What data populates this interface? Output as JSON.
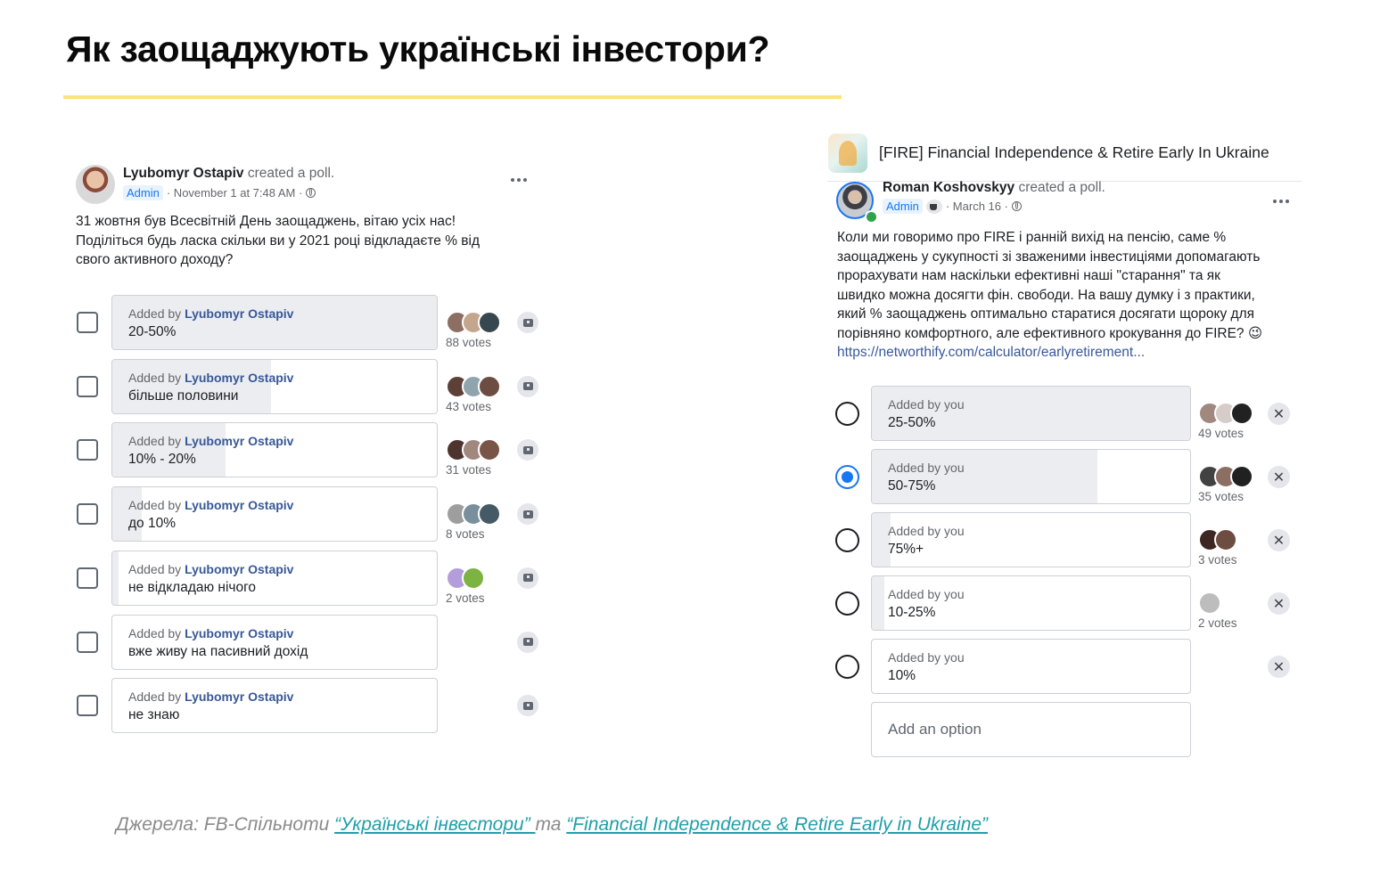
{
  "slide": {
    "title": "Як заощаджують українські інвестори?",
    "sources": {
      "prefix": "Джерела: FB-Спільноти ",
      "link1": "“Українські інвестори” ",
      "middle": "та ",
      "link2": "“Financial Independence & Retire Early in Ukraine”"
    }
  },
  "colors": {
    "accent_underline": "#fde27a",
    "facebook_blue": "#1877f2",
    "link_teal": "#1f9fa8"
  },
  "left_post": {
    "author": "Lyubomyr Ostapiv",
    "action": " created a poll.",
    "badge": "Admin",
    "meta": "· November 1 at 7:48 AM ·",
    "text": "31 жовтня був Всесвітній День заощаджень, вітаю усіх нас!\nПоділіться будь ласка скільки ви у 2021 році відкладаєте % від\nсвого активного доходу?",
    "added_by_prefix": "Added by ",
    "options": [
      {
        "added_by": "Lyubomyr Ostapiv",
        "label": "20-50%",
        "votes": "88 votes",
        "share": 1.0,
        "voters": 3
      },
      {
        "added_by": "Lyubomyr Ostapiv",
        "label": "більше половини",
        "votes": "43 votes",
        "share": 0.49,
        "voters": 3
      },
      {
        "added_by": "Lyubomyr Ostapiv",
        "label": "10% - 20%",
        "votes": "31 votes",
        "share": 0.35,
        "voters": 3
      },
      {
        "added_by": "Lyubomyr Ostapiv",
        "label": "до 10%",
        "votes": "8 votes",
        "share": 0.09,
        "voters": 3
      },
      {
        "added_by": "Lyubomyr Ostapiv",
        "label": "не відкладаю нічого",
        "votes": "2 votes",
        "share": 0.02,
        "voters": 2
      },
      {
        "added_by": "Lyubomyr Ostapiv",
        "label": "вже живу на пасивний дохід",
        "votes": "",
        "share": 0,
        "voters": 0
      },
      {
        "added_by": "Lyubomyr Ostapiv",
        "label": "не знаю",
        "votes": "",
        "share": 0,
        "voters": 0
      }
    ]
  },
  "right_post": {
    "group": "[FIRE] Financial Independence & Retire Early In Ukraine",
    "author": "Roman Koshovskyy",
    "action": " created a poll.",
    "badge": "Admin",
    "meta": "· March 16 ·",
    "text": "Коли ми говоримо про FIRE і ранній вихід на пенсію, саме %\nзаощаджень у сукупності зі зваженими інвестиціями допомагають\nпрорахувати нам наскільки ефективні наші \"старання\" та як\nшвидко можна досягти фін. свободи. На вашу думку і з практики,\nякий % заощаджень оптимально старатися досягати щороку для\nпорівняно комфортного, але ефективного крокування до FIRE? 😉",
    "link": "https://networthify.com/calculator/earlyretirement...",
    "options": [
      {
        "added_by": "Added by you",
        "label": "25-50%",
        "votes": "49 votes",
        "share": 1.0,
        "voters": 3,
        "selected": false
      },
      {
        "added_by": "Added by you",
        "label": "50-75%",
        "votes": "35 votes",
        "share": 0.71,
        "voters": 3,
        "selected": true
      },
      {
        "added_by": "Added by you",
        "label": "75%+",
        "votes": "3 votes",
        "share": 0.06,
        "voters": 2,
        "selected": false
      },
      {
        "added_by": "Added by you",
        "label": "10-25%",
        "votes": "2 votes",
        "share": 0.04,
        "voters": 1,
        "selected": false
      },
      {
        "added_by": "Added by you",
        "label": "10%",
        "votes": "",
        "share": 0,
        "voters": 0,
        "selected": false
      }
    ],
    "add_option_placeholder": "Add an option"
  }
}
